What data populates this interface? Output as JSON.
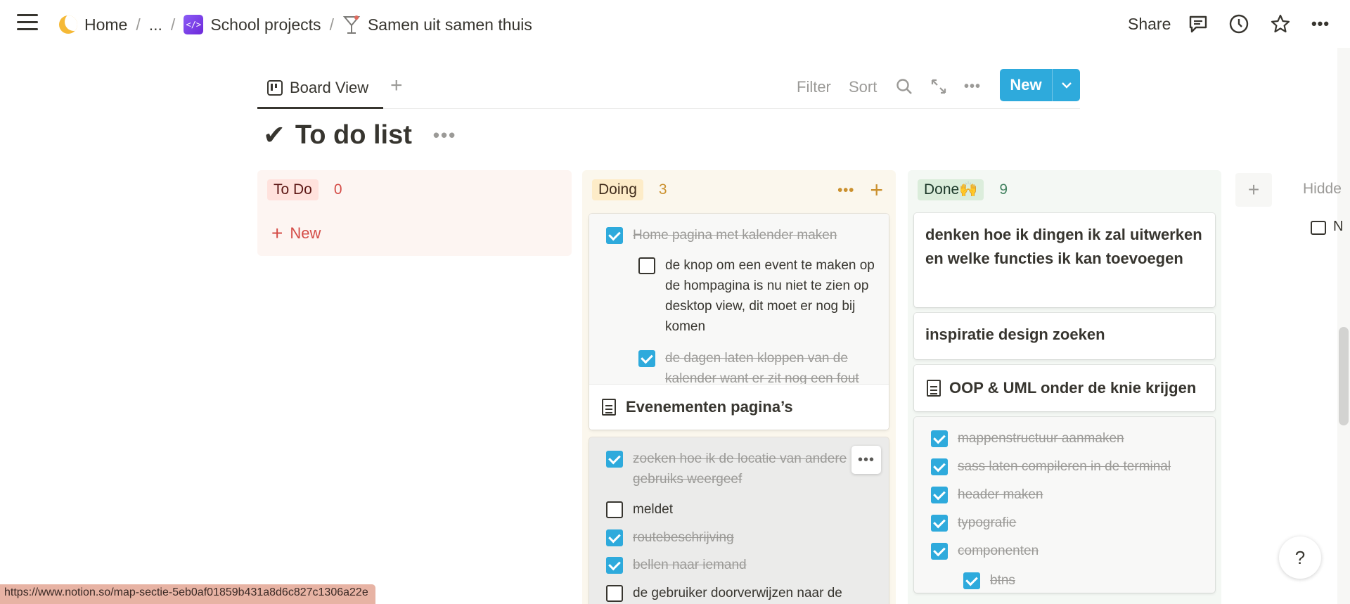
{
  "breadcrumb": {
    "home": "Home",
    "ellipsis": "...",
    "school": "School projects",
    "page": "Samen uit samen thuis",
    "separator": "/"
  },
  "topbar": {
    "share": "Share",
    "more": "•••"
  },
  "view": {
    "tab": "Board View",
    "add": "+",
    "filter": "Filter",
    "sort": "Sort",
    "more": "•••",
    "new_label": "New"
  },
  "title": {
    "check": "✔",
    "text": "To do list",
    "more": "•••"
  },
  "columns": {
    "todo": {
      "name": "To Do",
      "count": "0",
      "new": "New",
      "plus": "+"
    },
    "doing": {
      "name": "Doing",
      "count": "3",
      "more": "•••",
      "add": "+",
      "card1": {
        "items": [
          {
            "text": "Home pagina met kalender maken",
            "checked": true
          },
          {
            "text": "de knop om een event te maken op de hompagina is nu niet te zien op desktop view, dit moet er nog bij komen",
            "checked": false
          },
          {
            "text": "de dagen laten kloppen van de kalender want er zit nog een fout",
            "checked": true
          }
        ],
        "title": "Evenementen pagina’s"
      },
      "card2": {
        "items": [
          {
            "text": "zoeken hoe ik de locatie van andere gebruiks weergeef",
            "checked": true
          },
          {
            "text": "meldet",
            "checked": false
          },
          {
            "text": "routebeschrijving",
            "checked": true
          },
          {
            "text": "bellen naar iemand",
            "checked": true
          },
          {
            "text": "de gebruiker doorverwijzen naar de",
            "checked": false
          }
        ],
        "more": "•••"
      }
    },
    "done": {
      "name": "Done🙌",
      "count": "9",
      "cards": [
        "denken hoe ik dingen ik zal uitwerken en welke functies ik kan toevoegen",
        "inspiratie design zoeken",
        "OOP & UML onder de knie krijgen"
      ],
      "checklist": [
        {
          "text": "mappenstructuur aanmaken",
          "checked": true
        },
        {
          "text": "sass laten compileren in de terminal",
          "checked": true
        },
        {
          "text": "header maken",
          "checked": true
        },
        {
          "text": "typografie",
          "checked": true
        },
        {
          "text": "componenten",
          "checked": true
        },
        {
          "text": "btns",
          "checked": true
        }
      ]
    },
    "add_group": "+",
    "hidden": "Hidde",
    "hidden_item": "N"
  },
  "help": "?",
  "status_url": "https://www.notion.so/map-sectie-5eb0af01859b431a8d6c827c1306a22e",
  "colors": {
    "accent": "#2eaadc",
    "todo_bg": "#fdf5f2",
    "doing_bg": "#fbf7ed",
    "done_bg": "#f4f8f4"
  }
}
